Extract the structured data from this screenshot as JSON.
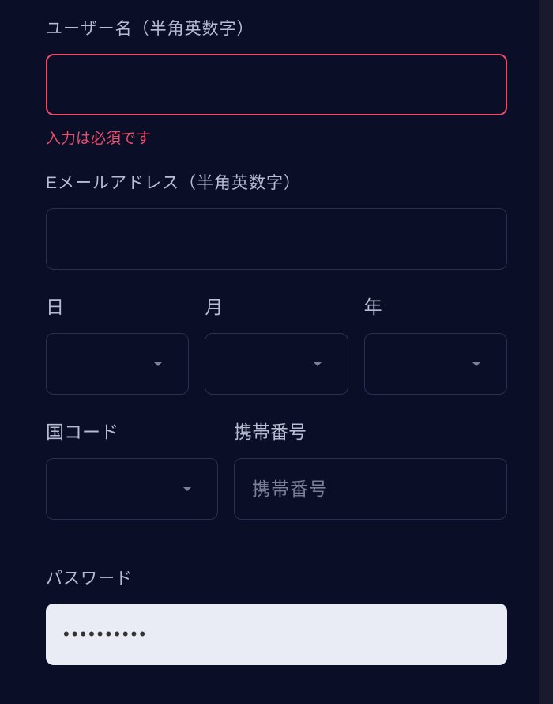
{
  "username": {
    "label": "ユーザー名（半角英数字）",
    "value": "",
    "error": "入力は必須です"
  },
  "email": {
    "label": "Eメールアドレス（半角英数字）",
    "value": ""
  },
  "date": {
    "day_label": "日",
    "month_label": "月",
    "year_label": "年"
  },
  "phone": {
    "code_label": "国コード",
    "number_label": "携帯番号",
    "number_placeholder": "携帯番号"
  },
  "password": {
    "label": "パスワード",
    "value": "••••••••••"
  }
}
